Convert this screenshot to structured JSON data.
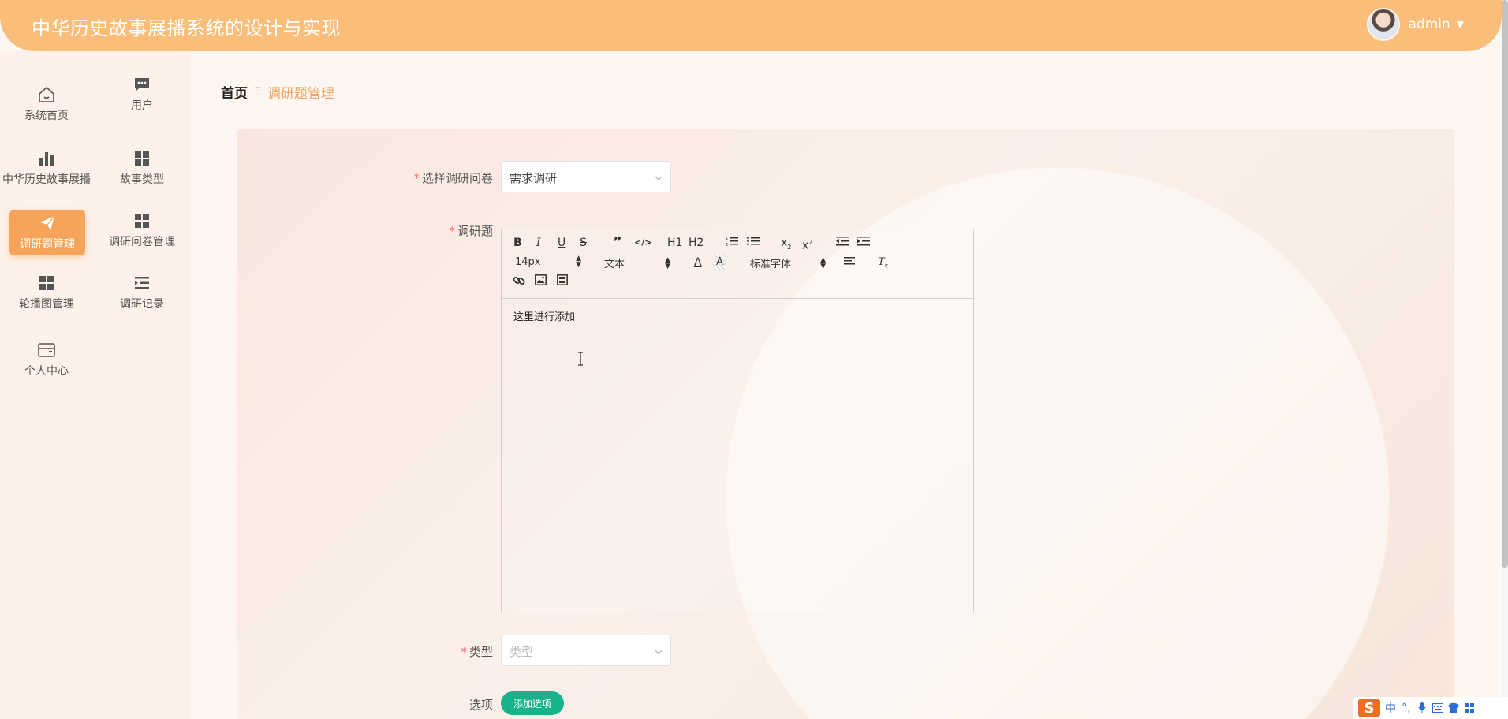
{
  "app": {
    "title": "中华历史故事展播系统的设计与实现"
  },
  "user": {
    "name": "admin"
  },
  "sidebar": {
    "items": [
      {
        "label": "系统首页",
        "icon": "home-icon"
      },
      {
        "label": "用户",
        "icon": "chat-icon"
      },
      {
        "label": "中华历史故事展播",
        "icon": "bar-chart-icon"
      },
      {
        "label": "故事类型",
        "icon": "grid-icon"
      },
      {
        "label": "调研题管理",
        "icon": "send-icon",
        "active": true
      },
      {
        "label": "调研问卷管理",
        "icon": "grid-icon"
      },
      {
        "label": "轮播图管理",
        "icon": "grid-icon"
      },
      {
        "label": "调研记录",
        "icon": "list-indent-icon"
      },
      {
        "label": "个人中心",
        "icon": "wallet-icon"
      }
    ]
  },
  "breadcrumb": {
    "home": "首页",
    "separator": "Ξ",
    "current": "调研题管理"
  },
  "form": {
    "questionnaire": {
      "label": "选择调研问卷",
      "value": "需求调研"
    },
    "question": {
      "label": "调研题",
      "content": "这里进行添加"
    },
    "type": {
      "label": "类型",
      "placeholder": "类型"
    },
    "options": {
      "label": "选项",
      "button": "添加选项"
    }
  },
  "editor": {
    "font_size": "14px",
    "text_style": "文本",
    "font_family": "标准字体",
    "h1": "H1",
    "h2": "H2"
  },
  "ime": {
    "mode": "中",
    "logo": "S"
  },
  "colors": {
    "header": "#fbbd7a",
    "accent": "#f5a45a",
    "button": "#17b38a",
    "required": "#f56c6c"
  }
}
